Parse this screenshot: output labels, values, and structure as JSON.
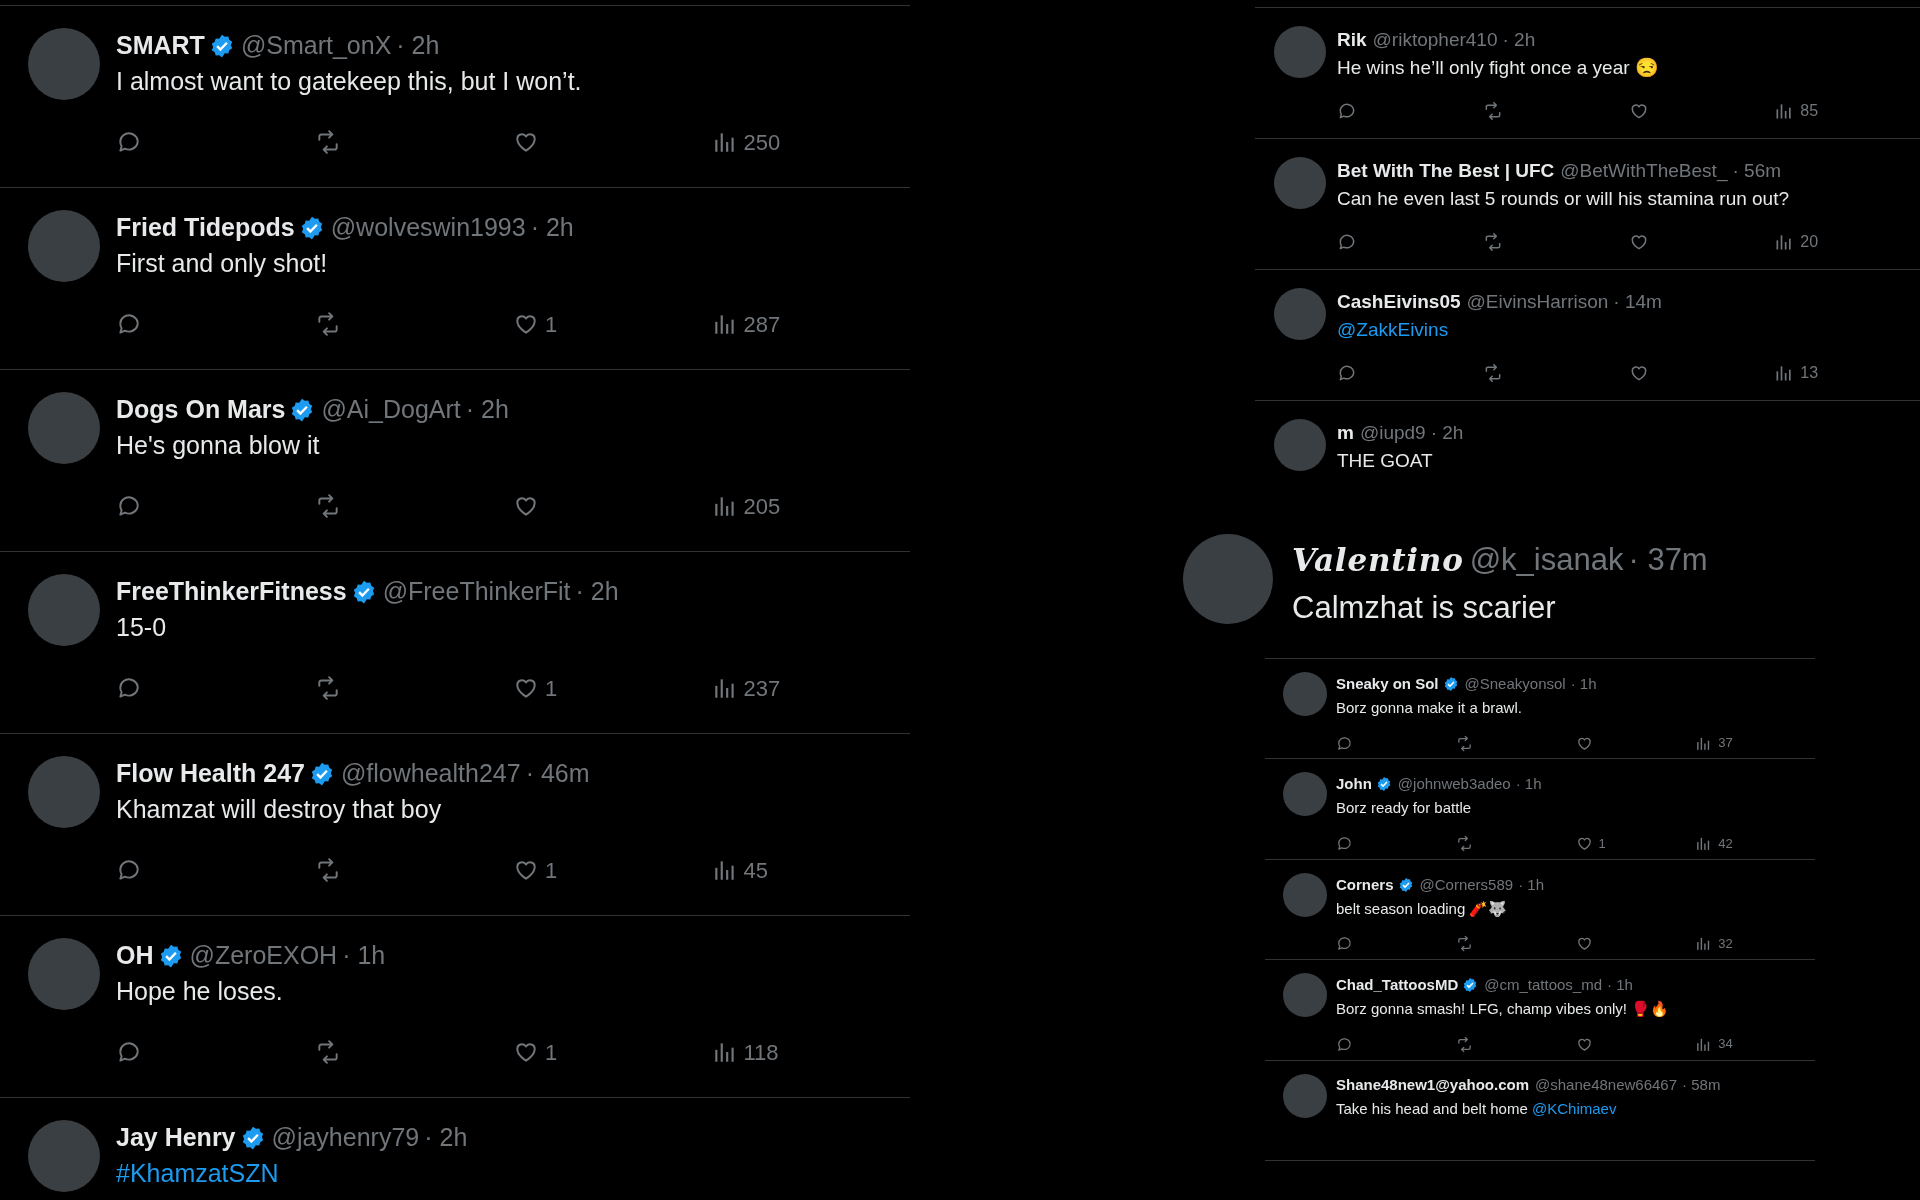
{
  "panels": [
    {
      "kind": "large",
      "tweets": [
        {
          "name": "SMART",
          "verified": true,
          "handle": "@Smart_onX",
          "time": "· 2h",
          "body": [
            {
              "kind": "text",
              "text": "I almost want to gatekeep this, but I won’t."
            }
          ],
          "actions": {
            "views": "250"
          }
        },
        {
          "name": "Fried Tidepods",
          "verified": true,
          "handle": "@wolveswin1993",
          "time": "· 2h",
          "body": [
            {
              "kind": "text",
              "text": "First and only shot!"
            }
          ],
          "actions": {
            "likes": "1",
            "views": "287"
          }
        },
        {
          "name": "Dogs On Mars",
          "verified": true,
          "handle": "@Ai_DogArt",
          "time": "· 2h",
          "body": [
            {
              "kind": "text",
              "text": "He's gonna blow it"
            }
          ],
          "actions": {
            "views": "205"
          }
        },
        {
          "name": "FreeThinkerFitness",
          "verified": true,
          "handle": "@FreeThinkerFit",
          "time": "· 2h",
          "body": [
            {
              "kind": "text",
              "text": "15-0"
            }
          ],
          "actions": {
            "likes": "1",
            "views": "237"
          }
        },
        {
          "name": "Flow Health 247",
          "verified": true,
          "handle": "@flowhealth247",
          "time": "· 46m",
          "body": [
            {
              "kind": "text",
              "text": "Khamzat will destroy that boy"
            }
          ],
          "actions": {
            "likes": "1",
            "views": "45"
          }
        },
        {
          "name": "OH",
          "verified": true,
          "handle": "@ZeroEXOH",
          "time": "· 1h",
          "body": [
            {
              "kind": "text",
              "text": "Hope he loses."
            }
          ],
          "actions": {
            "likes": "1",
            "views": "118"
          }
        },
        {
          "name": "Jay Henry",
          "verified": true,
          "handle": "@jayhenry79",
          "time": "· 2h",
          "body": [
            {
              "kind": "link",
              "text": "#KhamzatSZN"
            }
          ]
        }
      ]
    },
    {
      "kind": "medium",
      "tweets": [
        {
          "name": "Rik",
          "verified": false,
          "handle": "@riktopher410",
          "time": "· 2h",
          "body": [
            {
              "kind": "text",
              "text": "He wins he’ll only fight once a year 😒"
            }
          ],
          "actions": {
            "views": "85"
          }
        },
        {
          "name": "Bet With The Best | UFC",
          "verified": false,
          "handle": "@BetWithTheBest_",
          "time": "· 56m",
          "body": [
            {
              "kind": "text",
              "text": "Can he even last 5 rounds or will his stamina run out?"
            }
          ],
          "actions": {
            "views": "20"
          }
        },
        {
          "name": "CashEivins05",
          "verified": false,
          "handle": "@EivinsHarrison",
          "time": "· 14m",
          "body": [
            {
              "kind": "link",
              "text": "@ZakkEivins"
            }
          ],
          "actions": {
            "views": "13"
          }
        },
        {
          "name": "m",
          "verified": false,
          "handle": "@iupd9",
          "time": "· 2h",
          "body": [
            {
              "kind": "text",
              "text": "THE GOAT"
            }
          ]
        }
      ]
    },
    {
      "kind": "featured",
      "tweets": [
        {
          "name": "Valentino",
          "verified": false,
          "handle": "@k_isanak",
          "time": "· 37m",
          "body": [
            {
              "kind": "text",
              "text": "Calmzhat is scarier"
            }
          ]
        }
      ]
    },
    {
      "kind": "small",
      "tweets": [
        {
          "name": "Sneaky on Sol",
          "verified": true,
          "handle": "@Sneakyonsol",
          "time": "· 1h",
          "body": [
            {
              "kind": "text",
              "text": "Borz gonna make it a brawl."
            }
          ],
          "actions": {
            "views": "37"
          }
        },
        {
          "name": "John",
          "verified": true,
          "handle": "@johnweb3adeo",
          "time": "· 1h",
          "body": [
            {
              "kind": "text",
              "text": "Borz ready for battle"
            }
          ],
          "actions": {
            "likes": "1",
            "views": "42"
          }
        },
        {
          "name": "Corners",
          "verified": true,
          "handle": "@Corners589",
          "time": "· 1h",
          "body": [
            {
              "kind": "text",
              "text": "belt season loading 🧨🐺"
            }
          ],
          "actions": {
            "views": "32"
          }
        },
        {
          "name": "Chad_TattoosMD",
          "verified": true,
          "handle": "@cm_tattoos_md",
          "time": "· 1h",
          "body": [
            {
              "kind": "text",
              "text": "Borz gonna smash! LFG, champ vibes only! 🥊🔥"
            }
          ],
          "actions": {
            "views": "34"
          }
        },
        {
          "name": "Shane48new1@yahoo.com",
          "verified": false,
          "handle": "@shane48new66467",
          "time": "· 58m",
          "body": [
            {
              "kind": "text",
              "text": "Take his head and belt home "
            },
            {
              "kind": "link",
              "text": "@KChimaev"
            }
          ]
        }
      ]
    }
  ]
}
